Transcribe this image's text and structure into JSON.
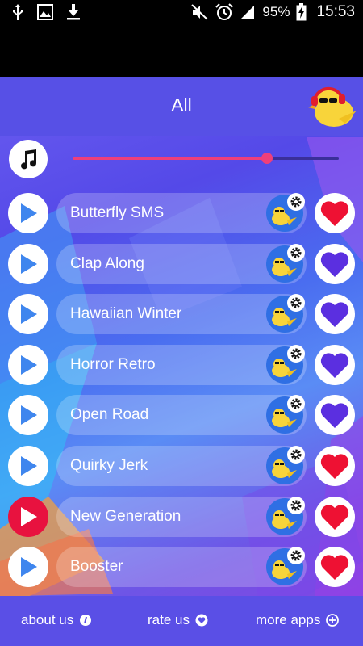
{
  "status_bar": {
    "battery": "95%",
    "time": "15:53",
    "icons": [
      "usb-icon",
      "image-icon",
      "download-icon",
      "mute-icon",
      "alarm-icon",
      "signal-icon",
      "battery-charging-icon"
    ]
  },
  "header": {
    "title": "All",
    "mascot_icon": "bird-headphones-icon"
  },
  "volume": {
    "icon": "music-note-icon",
    "level": 0.73,
    "color": "#ee3f7a"
  },
  "songs": [
    {
      "name": "Butterfly SMS",
      "favorite": true,
      "playing": false
    },
    {
      "name": "Clap Along",
      "favorite": false,
      "playing": false
    },
    {
      "name": "Hawaiian Winter",
      "favorite": false,
      "playing": false
    },
    {
      "name": "Horror Retro",
      "favorite": false,
      "playing": false
    },
    {
      "name": "Open Road",
      "favorite": false,
      "playing": false
    },
    {
      "name": "Quirky Jerk",
      "favorite": true,
      "playing": false
    },
    {
      "name": "New Generation",
      "favorite": true,
      "playing": true
    },
    {
      "name": "Booster",
      "favorite": true,
      "playing": false
    }
  ],
  "colors": {
    "play_triangle": "#3f86ee",
    "playing_bg": "#e8123f",
    "heart_favorite": "#ee1133",
    "heart_default": "#5b2fe0"
  },
  "bottom_bar": {
    "about_label": "about us",
    "rate_label": "rate us",
    "more_label": "more apps"
  }
}
